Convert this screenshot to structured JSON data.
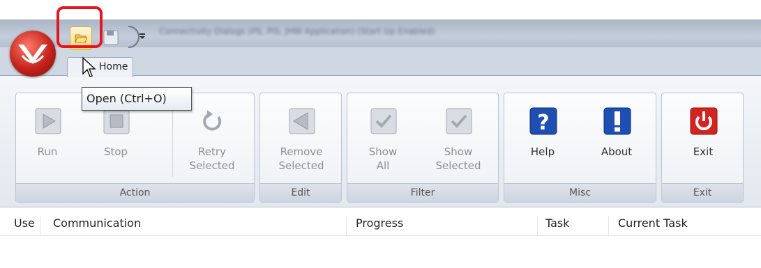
{
  "window": {
    "title": "Connectivity Dialogs (PS, PIS, JHW Application) (Start Up Enabled)"
  },
  "quick_access": {
    "open_icon": "folder-open-icon",
    "save_icon": "floppy-icon",
    "customize_icon": "dropdown-icon"
  },
  "ribbon": {
    "home_tab": "Home",
    "groups": {
      "action": {
        "label": "Action",
        "run": "Run",
        "stop": "Stop",
        "retry_line1": "Retry",
        "retry_line2": "Selected"
      },
      "edit": {
        "label": "Edit",
        "remove_line1": "Remove",
        "remove_line2": "Selected"
      },
      "filter": {
        "label": "Filter",
        "show_all_line1": "Show",
        "show_all_line2": "All",
        "show_sel_line1": "Show",
        "show_sel_line2": "Selected"
      },
      "misc": {
        "label": "Misc",
        "help": "Help",
        "about": "About"
      },
      "exit": {
        "label": "Exit",
        "exit": "Exit"
      }
    }
  },
  "tooltip": "Open (Ctrl+O)",
  "columns": [
    "Use",
    "Communication",
    "Progress",
    "Task",
    "Current Task"
  ],
  "colors": {
    "highlight": "#e8141b",
    "help_blue": "#1f4fb3",
    "exit_red": "#d32420"
  }
}
